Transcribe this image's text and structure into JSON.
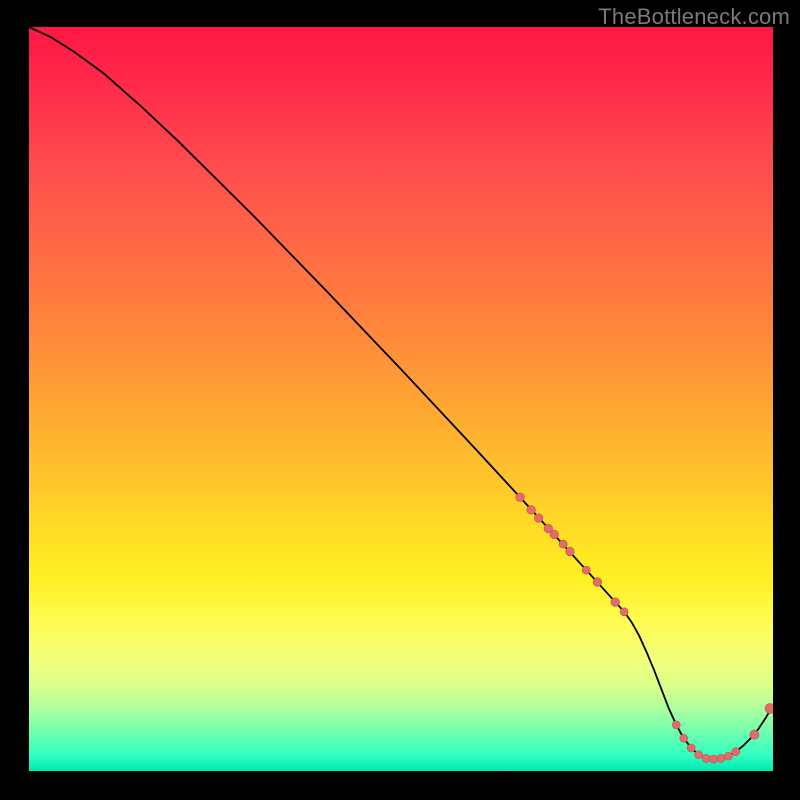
{
  "watermark": "TheBottleneck.com",
  "chart_data": {
    "type": "line",
    "title": "",
    "xlabel": "",
    "ylabel": "",
    "xlim": [
      0,
      100
    ],
    "ylim": [
      0,
      100
    ],
    "series": [
      {
        "name": "bottleneck-curve",
        "x": [
          0,
          3,
          6,
          10,
          15,
          20,
          30,
          40,
          50,
          60,
          66,
          68,
          70,
          72,
          74,
          76,
          78,
          80,
          81,
          82,
          83,
          84,
          85,
          86,
          87,
          88,
          89,
          90,
          91,
          92,
          93,
          94,
          95,
          96,
          97,
          98,
          99,
          100
        ],
        "y": [
          100,
          98.6,
          96.7,
          93.8,
          89.4,
          84.7,
          74.8,
          64.5,
          54.0,
          43.3,
          36.8,
          34.6,
          32.4,
          30.2,
          28.0,
          25.8,
          23.6,
          21.4,
          20.0,
          18.2,
          16.0,
          13.6,
          11.0,
          8.4,
          6.2,
          4.4,
          3.1,
          2.2,
          1.7,
          1.6,
          1.7,
          2.0,
          2.6,
          3.4,
          4.4,
          5.6,
          7.1,
          8.8
        ]
      }
    ],
    "points": {
      "name": "scatter-markers",
      "x": [
        66.0,
        67.5,
        68.5,
        69.8,
        70.6,
        71.8,
        72.7,
        74.9,
        76.4,
        78.8,
        80.0,
        87.0,
        88.0,
        89.0,
        90.0,
        91.0,
        92.0,
        93.0,
        94.0,
        95.0,
        97.5,
        99.6
      ],
      "y": [
        36.8,
        35.1,
        34.0,
        32.6,
        31.8,
        30.5,
        29.5,
        27.0,
        25.4,
        22.7,
        21.4,
        6.2,
        4.4,
        3.1,
        2.2,
        1.7,
        1.6,
        1.7,
        2.0,
        2.6,
        4.9,
        8.4
      ],
      "r": [
        4.3,
        4.3,
        4.3,
        4.3,
        4.3,
        4.0,
        4.3,
        4.0,
        4.3,
        4.3,
        4.0,
        4.0,
        4.0,
        4.0,
        4.0,
        4.0,
        4.0,
        4.0,
        4.0,
        4.0,
        4.6,
        5.0
      ]
    },
    "colors": {
      "curve": "#000000",
      "dot_fill": "#e36b6b",
      "dot_stroke": "#c24f4f",
      "gradient_top": "#ff1744",
      "gradient_mid": "#ffd327",
      "gradient_bottom": "#00e8b0"
    }
  }
}
